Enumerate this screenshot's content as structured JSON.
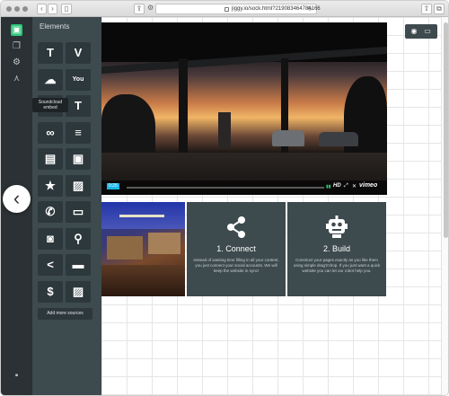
{
  "browser": {
    "url": "jiggy.io/sock.html?219083464784166",
    "back_glyph": "‹",
    "forward_glyph": "›"
  },
  "panel": {
    "title": "Elements",
    "tooltip": "Soundcloud embed",
    "add_sources_label": "Add more sources",
    "tiles": [
      {
        "name": "text-tile",
        "glyph": "T"
      },
      {
        "name": "vimeo-tile",
        "glyph": "V"
      },
      {
        "name": "soundcloud-tile",
        "glyph": "☁"
      },
      {
        "name": "youtube-tile",
        "glyph": "You"
      },
      {
        "name": "quote-tile",
        "glyph": "❝"
      },
      {
        "name": "heading-tile",
        "glyph": "T"
      },
      {
        "name": "link-tile",
        "glyph": "∞"
      },
      {
        "name": "paragraph-tile",
        "glyph": "≡"
      },
      {
        "name": "comment-tile",
        "glyph": "▤"
      },
      {
        "name": "gallery-tile",
        "glyph": "▣"
      },
      {
        "name": "star-tile",
        "glyph": "★"
      },
      {
        "name": "image-tile",
        "glyph": "▨"
      },
      {
        "name": "phone-tile",
        "glyph": "✆"
      },
      {
        "name": "chat-tile",
        "glyph": "▭"
      },
      {
        "name": "instagram-tile",
        "glyph": "◙"
      },
      {
        "name": "location-tile",
        "glyph": "⚲"
      },
      {
        "name": "share-tile",
        "glyph": "<"
      },
      {
        "name": "hotel-tile",
        "glyph": "▬"
      },
      {
        "name": "price-tile",
        "glyph": "$"
      },
      {
        "name": "picture-tile",
        "glyph": "▨"
      }
    ]
  },
  "video": {
    "time": "0:25",
    "hd_label": "HD",
    "provider_label": "vimeo"
  },
  "features": [
    {
      "title": "1. Connect",
      "description": "Instead of wasting time filling in all your content, you just connect your social accounts. We will keep the website in sync!"
    },
    {
      "title": "2. Build",
      "description": "Construct your pages exactly as you like them using simple drag'n'drop. If you just want a quick website you can let our robot help you."
    }
  ],
  "colors": {
    "rail_bg": "#2b3134",
    "panel_bg": "#3d4a4e",
    "tile_bg": "#2d383c",
    "accent": "#2fc77a",
    "vimeo_blue": "#1ab7ea"
  }
}
